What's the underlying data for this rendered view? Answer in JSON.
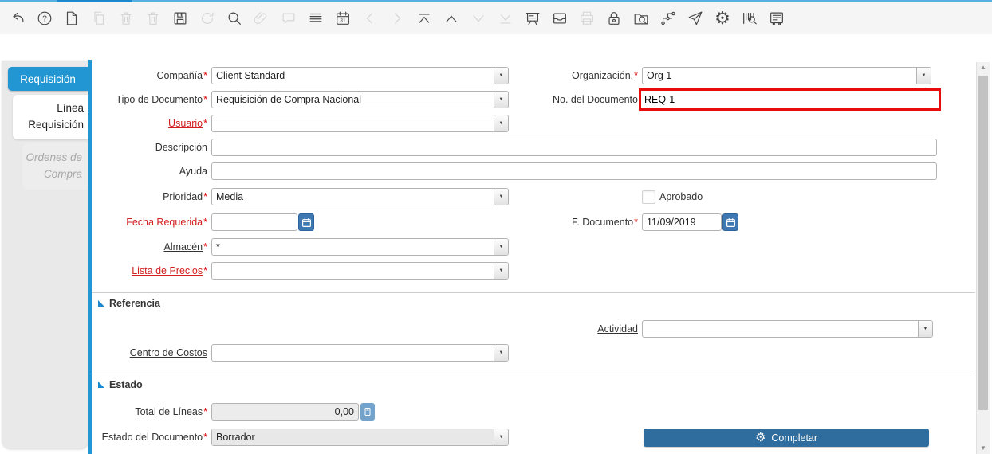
{
  "colors": {
    "accent_blue": "#2196d3",
    "topbar_light": "#55b0e2",
    "topbar_dark": "#1b87cc",
    "highlight_red": "#e80c0c",
    "mandatory_red": "#d22020",
    "complete_button_blue": "#2e6d9e",
    "date_button_blue": "#3d78b2",
    "calculator_button_blue": "#73a2cb"
  },
  "icons": {
    "dropdown_arrow": "▼",
    "scroll_up": "▲",
    "scroll_down": "▼",
    "gear": "⚙",
    "help_mark": "?",
    "calendar_day": "31"
  },
  "toolbar": {
    "items": [
      {
        "name": "undo",
        "enabled": true
      },
      {
        "name": "help",
        "enabled": true
      },
      {
        "name": "new-record",
        "enabled": true
      },
      {
        "name": "copy-record",
        "enabled": false
      },
      {
        "name": "delete-record",
        "enabled": false
      },
      {
        "name": "delete-selection",
        "enabled": false
      },
      {
        "name": "save",
        "enabled": true
      },
      {
        "name": "refresh",
        "enabled": false
      },
      {
        "name": "find",
        "enabled": true
      },
      {
        "name": "attachment",
        "enabled": false
      },
      {
        "name": "chat",
        "enabled": false
      },
      {
        "name": "grid-toggle",
        "enabled": true
      },
      {
        "name": "calendar",
        "enabled": true
      },
      {
        "name": "previous-record",
        "enabled": false
      },
      {
        "name": "next-record",
        "enabled": false
      },
      {
        "name": "first-record",
        "enabled": true
      },
      {
        "name": "parent-record",
        "enabled": true
      },
      {
        "name": "detail-record",
        "enabled": false
      },
      {
        "name": "last-record",
        "enabled": false
      },
      {
        "name": "report",
        "enabled": true
      },
      {
        "name": "archive",
        "enabled": true
      },
      {
        "name": "print",
        "enabled": false
      },
      {
        "name": "lock",
        "enabled": true
      },
      {
        "name": "zoom-across",
        "enabled": true
      },
      {
        "name": "workflow",
        "enabled": true
      },
      {
        "name": "send-mail",
        "enabled": true
      },
      {
        "name": "process",
        "enabled": true
      },
      {
        "name": "product-info",
        "enabled": true
      },
      {
        "name": "report-design",
        "enabled": true
      }
    ]
  },
  "sidebar": {
    "tabs": [
      {
        "label": "Requisición",
        "state": "active"
      },
      {
        "label": "Línea Requisición",
        "state": "enabled"
      },
      {
        "label": "Ordenes de Compra",
        "state": "disabled"
      }
    ]
  },
  "form": {
    "required_marker": "*",
    "fields": {
      "company": {
        "label": "Compañía",
        "value": "Client Standard"
      },
      "organization": {
        "label": "Organización.",
        "value": "Org 1"
      },
      "document_type": {
        "label": "Tipo de Documento",
        "value": "Requisición de Compra Nacional"
      },
      "document_no": {
        "label": "No. del Documento",
        "value": "REQ-1"
      },
      "user": {
        "label": "Usuario",
        "value": ""
      },
      "description": {
        "label": "Descripción",
        "value": ""
      },
      "help": {
        "label": "Ayuda",
        "value": ""
      },
      "priority": {
        "label": "Prioridad",
        "value": "Media"
      },
      "approved": {
        "label": "Aprobado",
        "checked": false
      },
      "date_required": {
        "label": "Fecha Requerida",
        "value": ""
      },
      "date_document": {
        "label": "F. Documento",
        "value": "11/09/2019"
      },
      "warehouse": {
        "label": "Almacén",
        "value": "*"
      },
      "price_list": {
        "label": "Lista de Precios",
        "value": ""
      },
      "activity": {
        "label": "Actividad",
        "value": ""
      },
      "cost_center": {
        "label": "Centro de Costos",
        "value": ""
      },
      "total_lines": {
        "label": "Total de Líneas",
        "value": "0,00"
      },
      "doc_status": {
        "label": "Estado del Documento",
        "value": "Borrador"
      }
    },
    "sections": {
      "reference": {
        "title": "Referencia"
      },
      "status": {
        "title": "Estado"
      }
    },
    "buttons": {
      "complete": {
        "label": "Completar"
      }
    }
  }
}
